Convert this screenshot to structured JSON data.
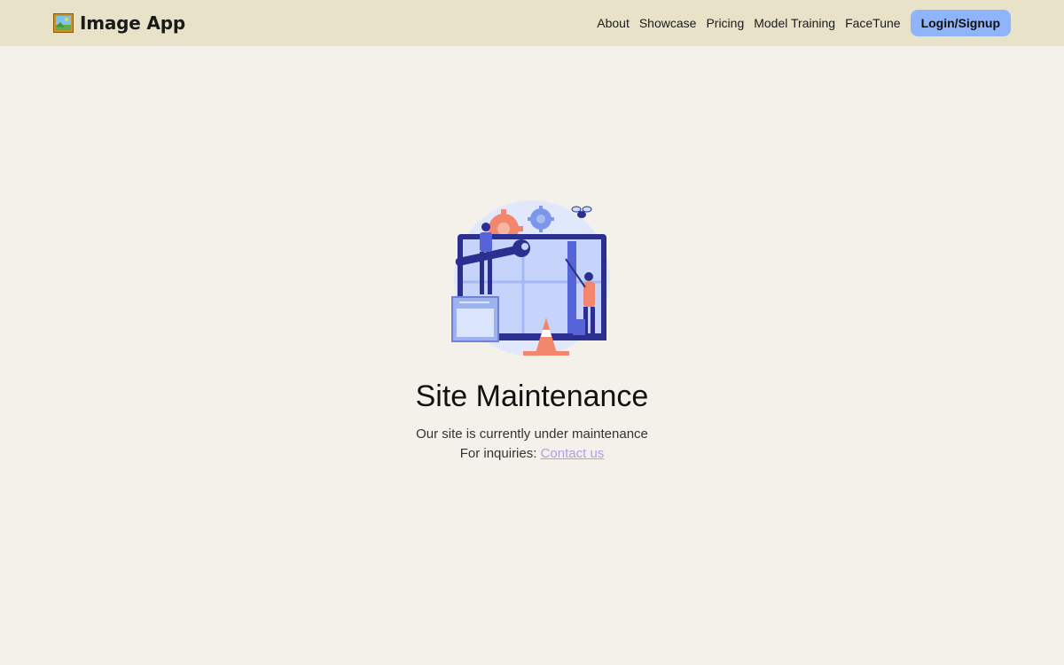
{
  "header": {
    "brand_name": "Image App",
    "brand_icon": "framed-picture-icon",
    "nav_items": [
      {
        "label": "About"
      },
      {
        "label": "Showcase"
      },
      {
        "label": "Pricing"
      },
      {
        "label": "Model Training"
      },
      {
        "label": "FaceTune"
      }
    ],
    "login_label": "Login/Signup"
  },
  "main": {
    "illustration": "maintenance-illustration",
    "title": "Site Maintenance",
    "subtitle": "Our site is currently under maintenance",
    "inquiry_prefix": "For inquiries: ",
    "contact_label": "Contact us"
  },
  "colors": {
    "page_background": "#f4f1ea",
    "header_background": "#e8e2c9",
    "login_button": "#8fb4fb",
    "contact_link": "#b59ae8"
  }
}
